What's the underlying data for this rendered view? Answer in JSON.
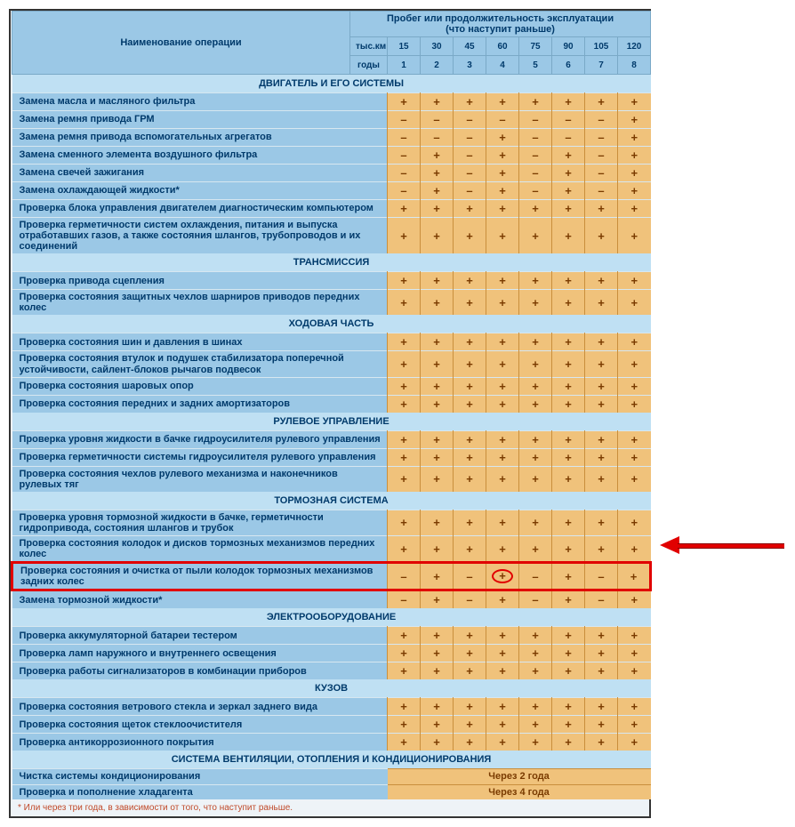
{
  "header": {
    "operation": "Наименование операции",
    "mileage": "Пробег или продолжительность эксплуатации\n(что наступит раньше)",
    "km_label": "тыс.км",
    "km": [
      "15",
      "30",
      "45",
      "60",
      "75",
      "90",
      "105",
      "120"
    ],
    "year_label": "годы",
    "years": [
      "1",
      "2",
      "3",
      "4",
      "5",
      "6",
      "7",
      "8"
    ]
  },
  "sections": [
    {
      "title": "ДВИГАТЕЛЬ И ЕГО СИСТЕМЫ",
      "rows": [
        {
          "op": "Замена масла и масляного фильтра",
          "v": [
            "+",
            "+",
            "+",
            "+",
            "+",
            "+",
            "+",
            "+"
          ]
        },
        {
          "op": "Замена ремня привода ГРМ",
          "v": [
            "–",
            "–",
            "–",
            "–",
            "–",
            "–",
            "–",
            "+"
          ]
        },
        {
          "op": "Замена ремня привода вспомогательных агрегатов",
          "v": [
            "–",
            "–",
            "–",
            "+",
            "–",
            "–",
            "–",
            "+"
          ]
        },
        {
          "op": "Замена сменного элемента воздушного фильтра",
          "v": [
            "–",
            "+",
            "–",
            "+",
            "–",
            "+",
            "–",
            "+"
          ]
        },
        {
          "op": "Замена свечей зажигания",
          "v": [
            "–",
            "+",
            "–",
            "+",
            "–",
            "+",
            "–",
            "+"
          ]
        },
        {
          "op": "Замена охлаждающей жидкости*",
          "v": [
            "–",
            "+",
            "–",
            "+",
            "–",
            "+",
            "–",
            "+"
          ]
        },
        {
          "op": "Проверка блока управления двигателем диагностическим компьютером",
          "v": [
            "+",
            "+",
            "+",
            "+",
            "+",
            "+",
            "+",
            "+"
          ]
        },
        {
          "op": "Проверка герметичности систем охлаждения, питания и выпуска отработавших газов, а также состояния шлангов, трубопроводов и их соединений",
          "v": [
            "+",
            "+",
            "+",
            "+",
            "+",
            "+",
            "+",
            "+"
          ]
        }
      ]
    },
    {
      "title": "ТРАНСМИССИЯ",
      "rows": [
        {
          "op": "Проверка привода сцепления",
          "v": [
            "+",
            "+",
            "+",
            "+",
            "+",
            "+",
            "+",
            "+"
          ]
        },
        {
          "op": "Проверка состояния защитных чехлов шарниров приводов передних колес",
          "v": [
            "+",
            "+",
            "+",
            "+",
            "+",
            "+",
            "+",
            "+"
          ]
        }
      ]
    },
    {
      "title": "ХОДОВАЯ ЧАСТЬ",
      "rows": [
        {
          "op": "Проверка состояния шин и давления в шинах",
          "v": [
            "+",
            "+",
            "+",
            "+",
            "+",
            "+",
            "+",
            "+"
          ]
        },
        {
          "op": "Проверка состояния втулок и подушек стабилизатора поперечной устойчивости, сайлент-блоков рычагов подвесок",
          "v": [
            "+",
            "+",
            "+",
            "+",
            "+",
            "+",
            "+",
            "+"
          ]
        },
        {
          "op": "Проверка состояния шаровых опор",
          "v": [
            "+",
            "+",
            "+",
            "+",
            "+",
            "+",
            "+",
            "+"
          ]
        },
        {
          "op": "Проверка состояния передних и задних амортизаторов",
          "v": [
            "+",
            "+",
            "+",
            "+",
            "+",
            "+",
            "+",
            "+"
          ]
        }
      ]
    },
    {
      "title": "РУЛЕВОЕ УПРАВЛЕНИЕ",
      "rows": [
        {
          "op": "Проверка уровня жидкости в бачке гидроусилителя рулевого управления",
          "v": [
            "+",
            "+",
            "+",
            "+",
            "+",
            "+",
            "+",
            "+"
          ]
        },
        {
          "op": "Проверка герметичности системы гидроусилителя рулевого управления",
          "v": [
            "+",
            "+",
            "+",
            "+",
            "+",
            "+",
            "+",
            "+"
          ]
        },
        {
          "op": "Проверка состояния чехлов рулевого механизма и наконечников рулевых тяг",
          "v": [
            "+",
            "+",
            "+",
            "+",
            "+",
            "+",
            "+",
            "+"
          ]
        }
      ]
    },
    {
      "title": "ТОРМОЗНАЯ СИСТЕМА",
      "rows": [
        {
          "op": "Проверка уровня тормозной жидкости в бачке, герметичности гидропривода, состояния шлангов и трубок",
          "v": [
            "+",
            "+",
            "+",
            "+",
            "+",
            "+",
            "+",
            "+"
          ]
        },
        {
          "op": "Проверка состояния колодок и дисков тормозных механизмов передних колес",
          "v": [
            "+",
            "+",
            "+",
            "+",
            "+",
            "+",
            "+",
            "+"
          ]
        },
        {
          "op": "Проверка состояния и очистка от пыли колодок тормозных механизмов задних колес",
          "v": [
            "–",
            "+",
            "–",
            "+",
            "–",
            "+",
            "–",
            "+"
          ],
          "highlight": true,
          "circle_index": 3
        },
        {
          "op": "Замена тормозной жидкости*",
          "v": [
            "–",
            "+",
            "–",
            "+",
            "–",
            "+",
            "–",
            "+"
          ]
        }
      ]
    },
    {
      "title": "ЭЛЕКТРООБОРУДОВАНИЕ",
      "rows": [
        {
          "op": "Проверка аккумуляторной батареи тестером",
          "v": [
            "+",
            "+",
            "+",
            "+",
            "+",
            "+",
            "+",
            "+"
          ]
        },
        {
          "op": "Проверка ламп наружного и внутреннего освещения",
          "v": [
            "+",
            "+",
            "+",
            "+",
            "+",
            "+",
            "+",
            "+"
          ]
        },
        {
          "op": "Проверка работы сигнализаторов в комбинации приборов",
          "v": [
            "+",
            "+",
            "+",
            "+",
            "+",
            "+",
            "+",
            "+"
          ]
        }
      ]
    },
    {
      "title": "КУЗОВ",
      "rows": [
        {
          "op": "Проверка состояния ветрового стекла и зеркал заднего вида",
          "v": [
            "+",
            "+",
            "+",
            "+",
            "+",
            "+",
            "+",
            "+"
          ]
        },
        {
          "op": "Проверка состояния щеток стеклоочистителя",
          "v": [
            "+",
            "+",
            "+",
            "+",
            "+",
            "+",
            "+",
            "+"
          ]
        },
        {
          "op": "Проверка антикоррозионного покрытия",
          "v": [
            "+",
            "+",
            "+",
            "+",
            "+",
            "+",
            "+",
            "+"
          ]
        }
      ]
    },
    {
      "title": "СИСТЕМА ВЕНТИЛЯЦИИ, ОТОПЛЕНИЯ И КОНДИЦИОНИРОВАНИЯ",
      "rows": [
        {
          "op": "Чистка системы кондиционирования",
          "span": "Через 2 года"
        },
        {
          "op": "Проверка и пополнение хладагента",
          "span": "Через 4 года"
        }
      ]
    }
  ],
  "footnote": "*  Или через три года, в зависимости от того, что наступит раньше."
}
